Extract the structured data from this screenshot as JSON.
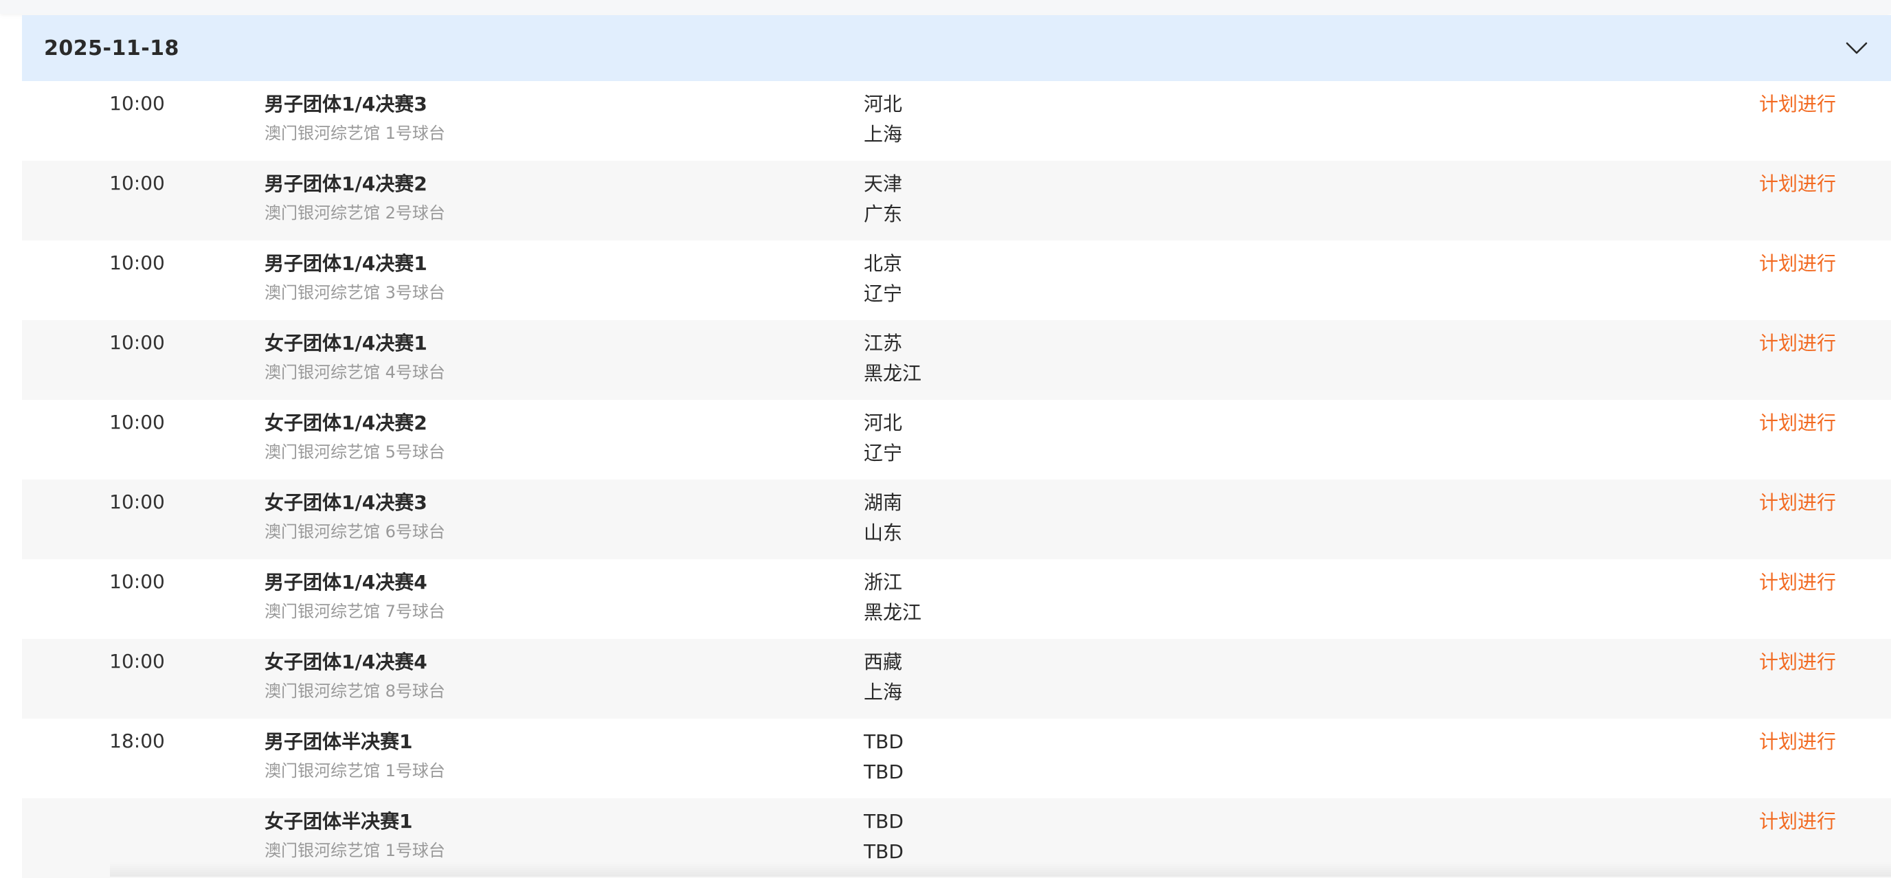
{
  "schedule": {
    "date": "2025-11-18",
    "rows": [
      {
        "time": "10:00",
        "match": "男子团体1/4决赛3",
        "venue": "澳门银河综艺馆 1号球台",
        "team1": "河北",
        "team2": "上海",
        "status": "计划进行"
      },
      {
        "time": "10:00",
        "match": "男子团体1/4决赛2",
        "venue": "澳门银河综艺馆 2号球台",
        "team1": "天津",
        "team2": "广东",
        "status": "计划进行"
      },
      {
        "time": "10:00",
        "match": "男子团体1/4决赛1",
        "venue": "澳门银河综艺馆 3号球台",
        "team1": "北京",
        "team2": "辽宁",
        "status": "计划进行"
      },
      {
        "time": "10:00",
        "match": "女子团体1/4决赛1",
        "venue": "澳门银河综艺馆 4号球台",
        "team1": "江苏",
        "team2": "黑龙江",
        "status": "计划进行"
      },
      {
        "time": "10:00",
        "match": "女子团体1/4决赛2",
        "venue": "澳门银河综艺馆 5号球台",
        "team1": "河北",
        "team2": "辽宁",
        "status": "计划进行"
      },
      {
        "time": "10:00",
        "match": "女子团体1/4决赛3",
        "venue": "澳门银河综艺馆 6号球台",
        "team1": "湖南",
        "team2": "山东",
        "status": "计划进行"
      },
      {
        "time": "10:00",
        "match": "男子团体1/4决赛4",
        "venue": "澳门银河综艺馆 7号球台",
        "team1": "浙江",
        "team2": "黑龙江",
        "status": "计划进行"
      },
      {
        "time": "10:00",
        "match": "女子团体1/4决赛4",
        "venue": "澳门银河综艺馆 8号球台",
        "team1": "西藏",
        "team2": "上海",
        "status": "计划进行"
      },
      {
        "time": "18:00",
        "match": "男子团体半决赛1",
        "venue": "澳门银河综艺馆 1号球台",
        "team1": "TBD",
        "team2": "TBD",
        "status": "计划进行"
      },
      {
        "time": "",
        "match": "女子团体半决赛1",
        "venue": "澳门银河综艺馆 1号球台",
        "team1": "TBD",
        "team2": "TBD",
        "status": "计划进行"
      }
    ]
  },
  "colors": {
    "header_bg": "#e1eefd",
    "status": "#f26a21",
    "row_alt": "#f7f7f7",
    "venue_text": "#999999"
  },
  "icons": {
    "collapse": "chevron-down-icon"
  }
}
